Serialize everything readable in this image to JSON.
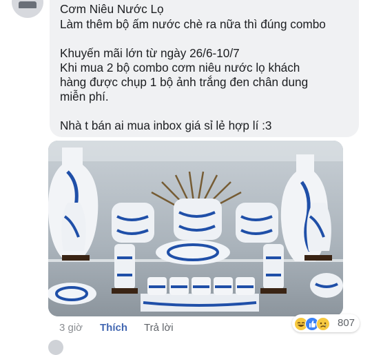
{
  "comment": {
    "lines": [
      "Cơm Niêu Nước Lọ",
      "Làm thêm bộ ấm nước chè ra nữa thì đúng combo",
      "",
      "Khuyến mãi lớn từ ngày 26/6-10/7",
      "Khi mua 2 bộ combo cơm niêu nước lọ khách",
      "hàng được chụp 1 bộ ảnh trắng đen chân dung",
      "miễn phí.",
      "",
      "Nhà t bán ai mua inbox giá sỉ lẻ hợp lí :3"
    ]
  },
  "actions": {
    "time": "3 giờ",
    "like": "Thích",
    "reply": "Trả lời"
  },
  "reactions": {
    "icons": [
      "haha-icon",
      "like-icon",
      "sad-icon"
    ],
    "count": "807"
  },
  "colors": {
    "bubble": "#f0f1f3",
    "link": "#4267b2",
    "muted": "#8a8d91",
    "porcelain_blue": "#1f4fa8"
  }
}
